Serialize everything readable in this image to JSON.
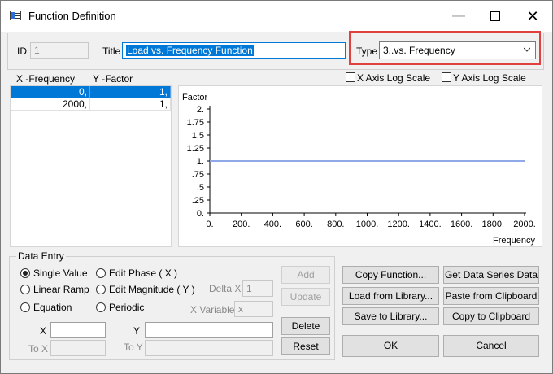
{
  "window": {
    "title": "Function Definition",
    "min_glyph": "—",
    "close_glyph": "✕"
  },
  "header": {
    "id_label": "ID",
    "id_value": "1",
    "title_label": "Title",
    "title_value": "Load vs. Frequency Function",
    "type_label": "Type",
    "type_value": "3..vs. Frequency",
    "highlight_color": "#e0413f"
  },
  "table": {
    "columns": [
      "X -Frequency",
      "Y -Factor"
    ],
    "rows": [
      {
        "x": "0,",
        "y": "1,"
      },
      {
        "x": "2000,",
        "y": "1,"
      }
    ],
    "selected_row": 0
  },
  "options": {
    "x_log_label": "X Axis Log Scale",
    "y_log_label": "Y Axis Log Scale",
    "x_log_checked": false,
    "y_log_checked": false
  },
  "chart_data": {
    "type": "line",
    "ylabel": "Factor",
    "xlabel": "Frequency",
    "x_ticks": [
      "0.",
      "200.",
      "400.",
      "600.",
      "800.",
      "1000.",
      "1200.",
      "1400.",
      "1600.",
      "1800.",
      "2000."
    ],
    "y_ticks": [
      "0.",
      ".25",
      ".5",
      ".75",
      "1.",
      "1.25",
      "1.5",
      "1.75",
      "2."
    ],
    "xlim": [
      0,
      2000
    ],
    "ylim": [
      0,
      2
    ],
    "series": [
      {
        "x": [
          0,
          2000
        ],
        "y": [
          1,
          1
        ],
        "color": "#8fa8e8"
      }
    ]
  },
  "data_entry": {
    "title": "Data Entry",
    "radios": {
      "single_value": "Single Value",
      "linear_ramp": "Linear Ramp",
      "equation": "Equation",
      "edit_phase": "Edit Phase ( X )",
      "edit_magnitude": "Edit Magnitude ( Y )",
      "periodic": "Periodic"
    },
    "selected": "single_value",
    "delta_x_label": "Delta X",
    "delta_x_value": "1",
    "x_variable_label": "X Variable",
    "x_variable_value": "x",
    "x_label": "X",
    "y_label": "Y",
    "to_x_label": "To X",
    "to_y_label": "To Y",
    "x_value": "",
    "y_value": "",
    "add": "Add",
    "update": "Update",
    "delete": "Delete",
    "reset": "Reset"
  },
  "actions": {
    "copy_function": "Copy Function...",
    "get_series": "Get Data Series Data",
    "load_library": "Load from Library...",
    "paste_clipboard": "Paste from Clipboard",
    "save_library": "Save to Library...",
    "copy_clipboard": "Copy to Clipboard",
    "ok": "OK",
    "cancel": "Cancel"
  }
}
